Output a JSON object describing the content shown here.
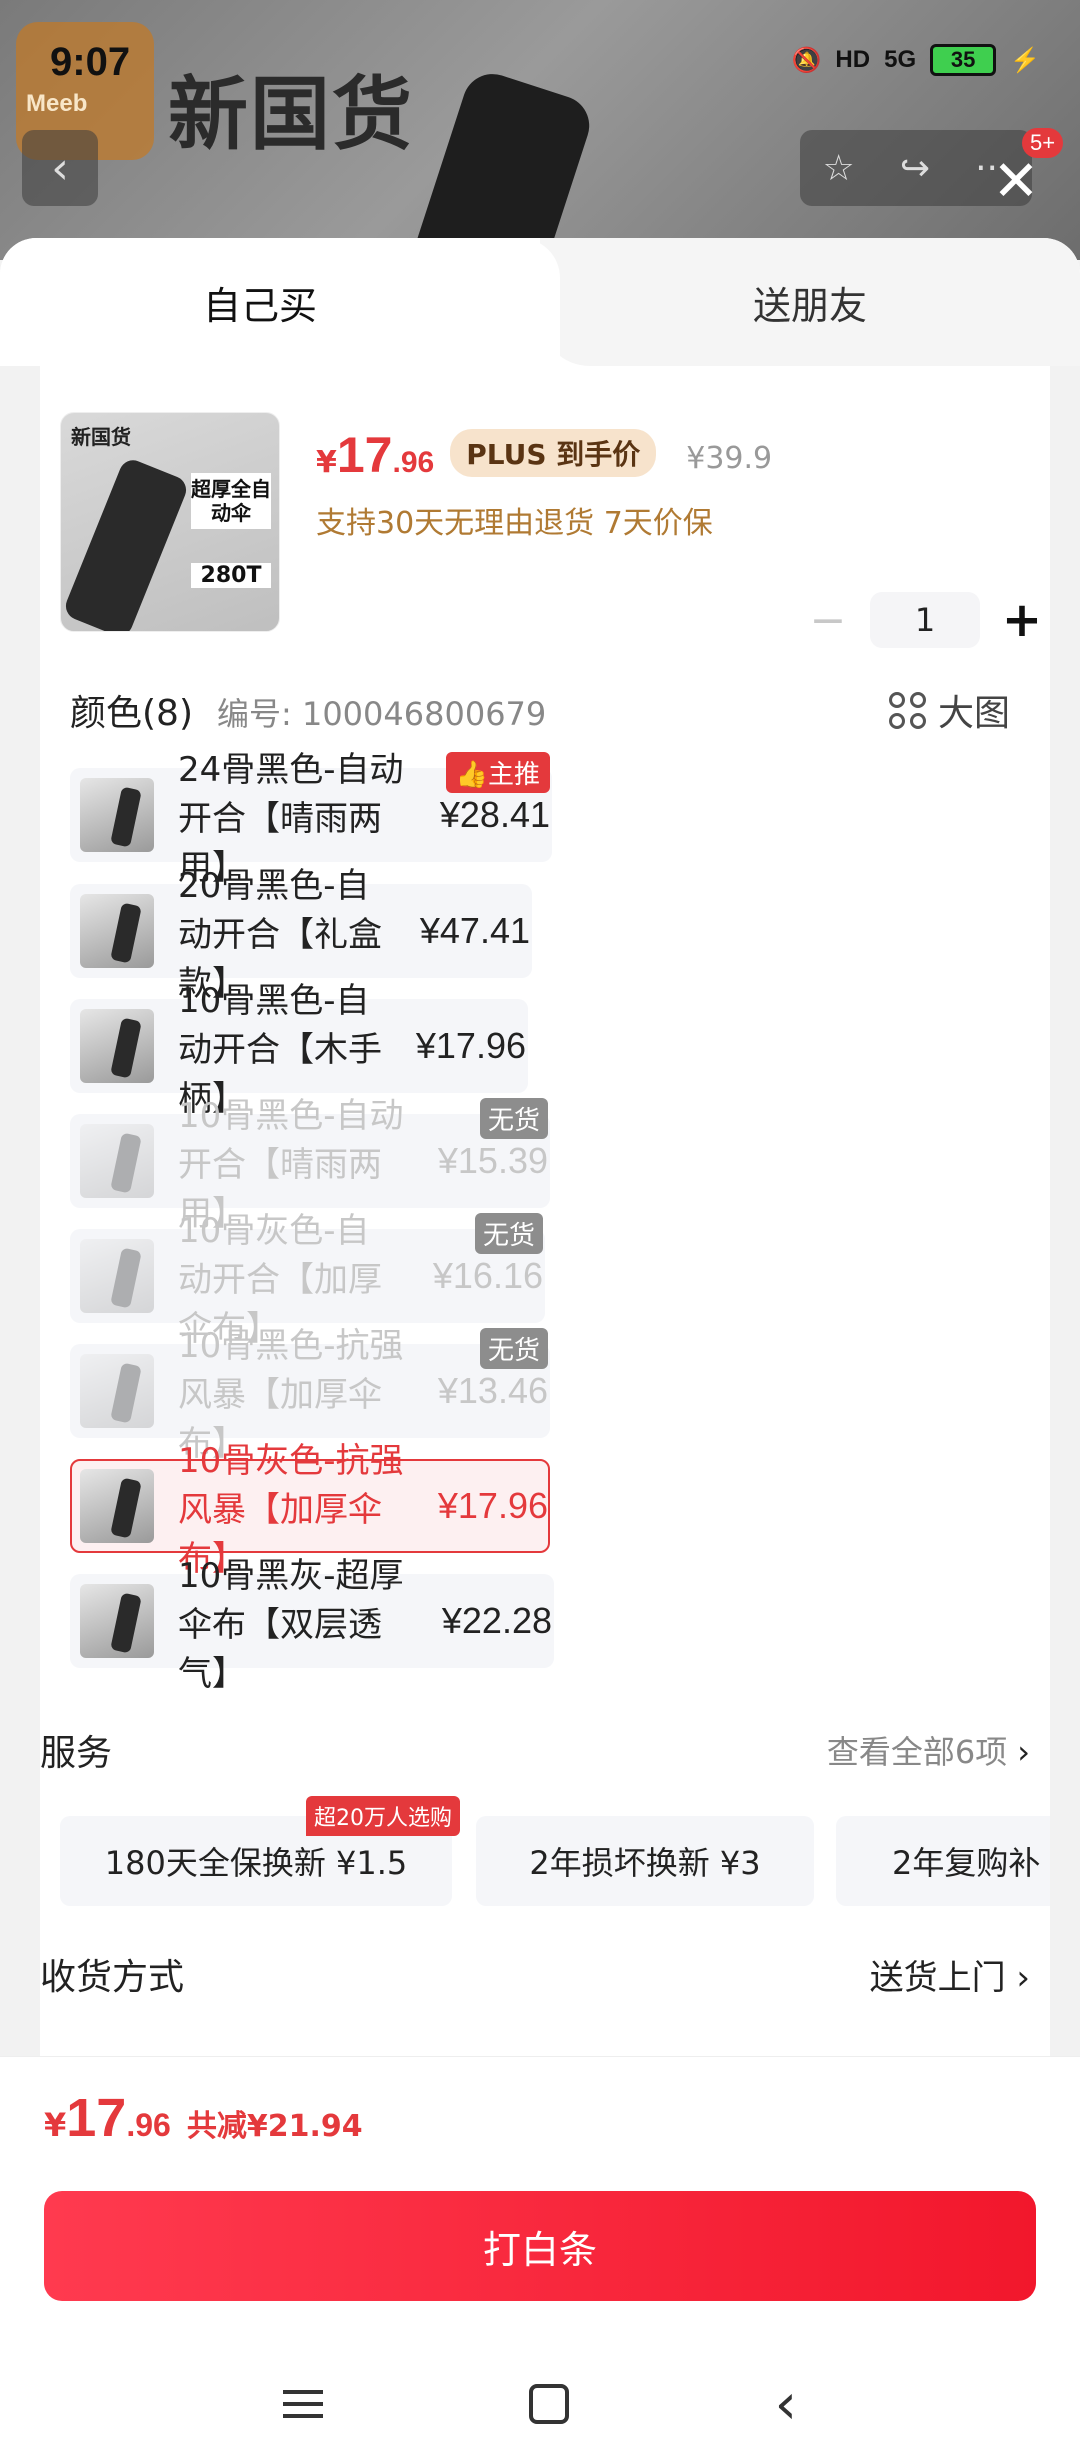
{
  "status_bar": {
    "time": "9:07",
    "network": "5G",
    "battery": "35",
    "hd": "HD"
  },
  "background": {
    "brand": "新国货",
    "logo_text": "Meeb",
    "notif_count": "5+"
  },
  "tabs": [
    {
      "label": "自己买"
    },
    {
      "label": "送朋友"
    }
  ],
  "product": {
    "price_yen": "¥",
    "price_int": "17",
    "price_dec": ".96",
    "plus_label": "PLUS 到手价",
    "original_price": "¥39.9",
    "guarantee": "支持30天无理由退货 7天价保",
    "thumb_brand": "新国货",
    "thumb_label": "超厚全自动伞",
    "thumb_label2": "280T"
  },
  "quantity": {
    "minus": "−",
    "value": "1",
    "plus": "+"
  },
  "color_section": {
    "title": "颜色(8)",
    "code": "编号: 100046800679",
    "big_image": "大图"
  },
  "specs": [
    {
      "label": "24骨黑色-自动开合【晴雨两用】",
      "price": "¥28.41",
      "tag": "主推"
    },
    {
      "label": "20骨黑色-自动开合【礼盒款】",
      "price": "¥47.41"
    },
    {
      "label": "10骨黑色-自动开合【木手柄】",
      "price": "¥17.96"
    },
    {
      "label": "10骨黑色-自动开合【晴雨两用】",
      "price": "¥15.39",
      "tag": "无货"
    },
    {
      "label": "10骨灰色-自动开合【加厚伞布】",
      "price": "¥16.16",
      "tag": "无货"
    },
    {
      "label": "10骨黑色-抗强风暴【加厚伞布】",
      "price": "¥13.46",
      "tag": "无货"
    },
    {
      "label": "10骨灰色-抗强风暴【加厚伞布】",
      "price": "¥17.96"
    },
    {
      "label": "10骨黑灰-超厚伞布【双层透气】",
      "price": "¥22.28"
    }
  ],
  "services": {
    "title": "服务",
    "more": "查看全部6项",
    "hot_tag": "超20万人选购",
    "items": [
      "180天全保换新  ¥1.5",
      "2年损坏换新  ¥3",
      "2年复购补"
    ]
  },
  "shipping": {
    "title": "收货方式",
    "value": "送货上门"
  },
  "footer": {
    "total_yen": "¥",
    "total_int": "17",
    "total_dec": ".96",
    "saving": "共减¥21.94",
    "pay_button": "打白条"
  },
  "colors": {
    "accent": "#e4393c",
    "gold": "#b07a33"
  }
}
